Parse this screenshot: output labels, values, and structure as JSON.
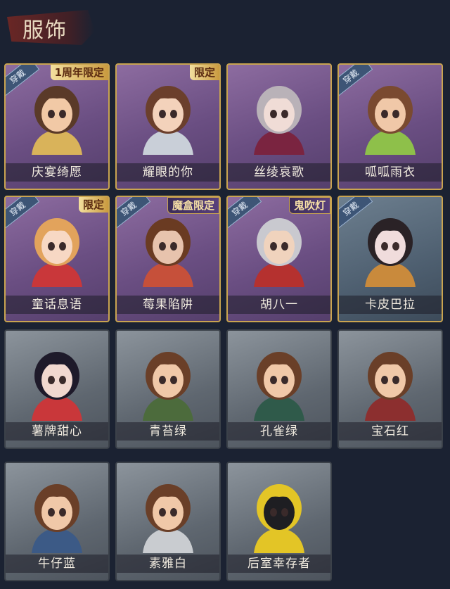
{
  "header": {
    "title": "服饰"
  },
  "tags": {
    "wear": "穿戴"
  },
  "costumes": [
    {
      "name": "庆宴绮愿",
      "worn": true,
      "limit": "1周年限定",
      "style": "purple",
      "skin": "#f1c9a6",
      "hair": "#5a3a28",
      "accent": "#d9b35a"
    },
    {
      "name": "耀眼的你",
      "worn": false,
      "limit": "限定",
      "style": "purple",
      "skin": "#f3d2bb",
      "hair": "#6b3f2c",
      "accent": "#c9cfd8"
    },
    {
      "name": "丝绫哀歌",
      "worn": false,
      "limit": "",
      "style": "purple",
      "skin": "#f0dcd6",
      "hair": "#b9b2b8",
      "accent": "#7a2440"
    },
    {
      "name": "呱呱雨衣",
      "worn": true,
      "limit": "",
      "style": "purple",
      "skin": "#f0c8a8",
      "hair": "#7a4a30",
      "accent": "#8ec04a"
    },
    {
      "name": "童话息语",
      "worn": true,
      "limit": "限定",
      "style": "purple",
      "skin": "#f7d8c4",
      "hair": "#e2a35c",
      "accent": "#c9373a"
    },
    {
      "name": "莓果陷阱",
      "worn": true,
      "limit": "魔盒限定",
      "style": "purple",
      "skin": "#e7c3ad",
      "hair": "#6a3b22",
      "accent": "#c6503a"
    },
    {
      "name": "胡八一",
      "worn": true,
      "limit": "鬼吹灯",
      "style": "purple",
      "skin": "#f0d3bd",
      "hair": "#c9c9cf",
      "accent": "#b5312f"
    },
    {
      "name": "卡皮巴拉",
      "worn": true,
      "limit": "",
      "style": "steel",
      "skin": "#f0dcdc",
      "hair": "#2a2226",
      "accent": "#c98a3c"
    },
    {
      "name": "薯牌甜心",
      "worn": false,
      "limit": "",
      "style": "gray",
      "skin": "#f1d8cf",
      "hair": "#1e1a2a",
      "accent": "#c9373a"
    },
    {
      "name": "青苔绿",
      "worn": false,
      "limit": "",
      "style": "gray",
      "skin": "#f0c8a8",
      "hair": "#6a3f28",
      "accent": "#4c6b3c"
    },
    {
      "name": "孔雀绿",
      "worn": false,
      "limit": "",
      "style": "gray",
      "skin": "#f0c8a8",
      "hair": "#6a3f28",
      "accent": "#2f5a4a"
    },
    {
      "name": "宝石红",
      "worn": false,
      "limit": "",
      "style": "gray",
      "skin": "#f0c8a8",
      "hair": "#6a3f28",
      "accent": "#8c2f2f"
    },
    {
      "name": "牛仔蓝",
      "worn": false,
      "limit": "",
      "style": "gray",
      "skin": "#f0c8a8",
      "hair": "#6a3f28",
      "accent": "#3c5a86"
    },
    {
      "name": "素雅白",
      "worn": false,
      "limit": "",
      "style": "gray",
      "skin": "#f0c8a8",
      "hair": "#6a3f28",
      "accent": "#c9ccd0"
    },
    {
      "name": "后室幸存者",
      "worn": false,
      "limit": "",
      "style": "gray",
      "skin": "#1e1e22",
      "hair": "#e3c526",
      "accent": "#e3c526"
    }
  ]
}
